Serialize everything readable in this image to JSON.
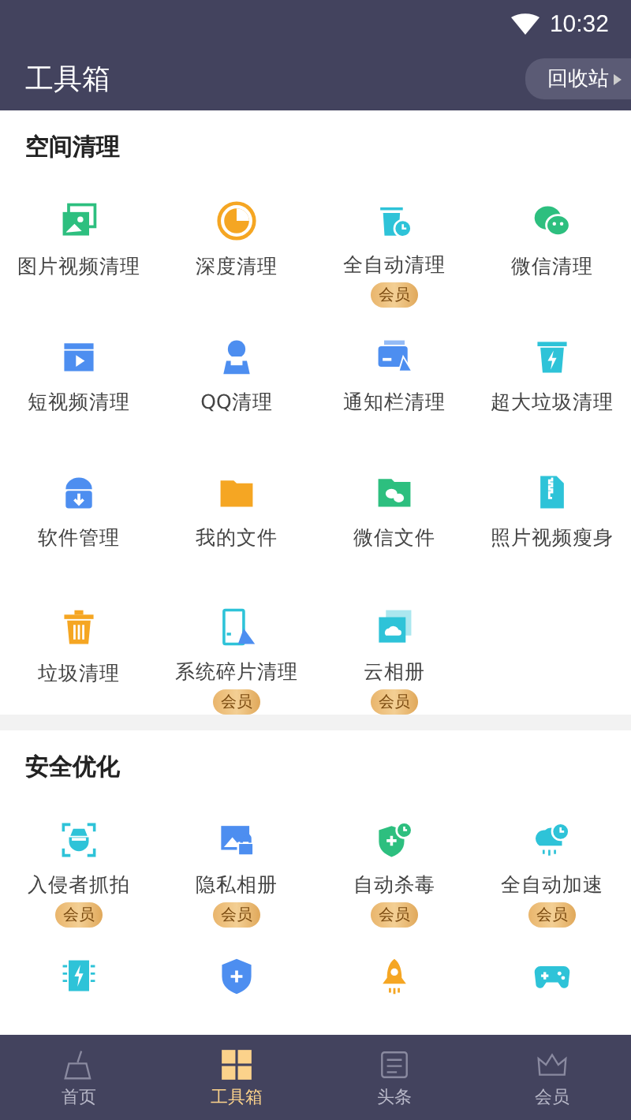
{
  "status_bar": {
    "time": "10:32"
  },
  "header": {
    "title": "工具箱",
    "action": "回收站"
  },
  "sections": [
    {
      "title": "空间清理",
      "items": [
        {
          "label": "图片视频清理"
        },
        {
          "label": "深度清理"
        },
        {
          "label": "全自动清理",
          "badge": "会员"
        },
        {
          "label": "微信清理"
        },
        {
          "label": "短视频清理"
        },
        {
          "label": "QQ清理"
        },
        {
          "label": "通知栏清理"
        },
        {
          "label": "超大垃圾清理"
        },
        {
          "label": "软件管理"
        },
        {
          "label": "我的文件"
        },
        {
          "label": "微信文件"
        },
        {
          "label": "照片视频瘦身"
        },
        {
          "label": "垃圾清理"
        },
        {
          "label": "系统碎片清理",
          "badge": "会员"
        },
        {
          "label": "云相册",
          "badge": "会员"
        }
      ]
    },
    {
      "title": "安全优化",
      "items": [
        {
          "label": "入侵者抓拍",
          "badge": "会员"
        },
        {
          "label": "隐私相册",
          "badge": "会员"
        },
        {
          "label": "自动杀毒",
          "badge": "会员"
        },
        {
          "label": "全自动加速",
          "badge": "会员"
        }
      ]
    }
  ],
  "nav": [
    {
      "label": "首页",
      "selected": false
    },
    {
      "label": "工具箱",
      "selected": true
    },
    {
      "label": "头条",
      "selected": false
    },
    {
      "label": "会员",
      "selected": false
    }
  ]
}
